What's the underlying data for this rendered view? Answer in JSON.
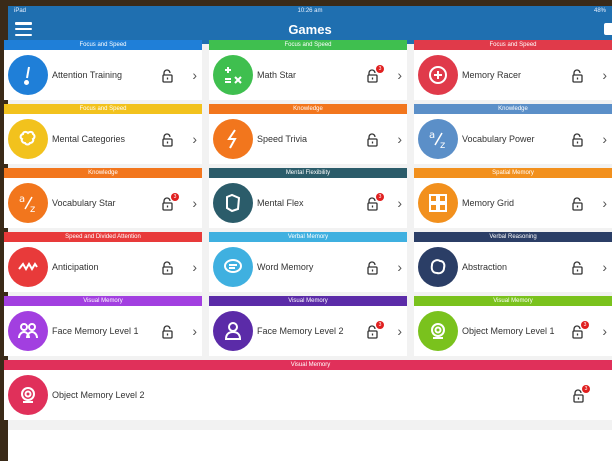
{
  "status": {
    "left": "iPad",
    "time": "10:26 am",
    "right": "48%"
  },
  "nav": {
    "title": "Games"
  },
  "colors": {
    "focus": "#1f7fd8",
    "knowledge": "#f2761d",
    "flex": "#2b5c6a",
    "spatial": "#f2761d",
    "speed": "#e83a3a",
    "verbal": "#6fd0ec",
    "reason": "#6b6e86",
    "visual": "#a23fe0"
  },
  "rows": [
    [
      {
        "category": "Focus and Speed",
        "name": "Attention Training",
        "icon": "exclamation-icon",
        "color": "#1f7fd8",
        "badge": ""
      },
      {
        "category": "Focus and Speed",
        "name": "Math Star",
        "icon": "math-symbols-icon",
        "color": "#3fbf4f",
        "badge": "3"
      },
      {
        "category": "Focus and Speed",
        "name": "Memory Racer",
        "icon": "target-face-icon",
        "color": "#e03a4a",
        "badge": ""
      }
    ],
    [
      {
        "category": "Focus and Speed",
        "name": "Mental Categories",
        "icon": "brain-icon",
        "color": "#f2c21d",
        "badge": ""
      },
      {
        "category": "Knowledge",
        "name": "Speed Trivia",
        "icon": "lightning-icon",
        "color": "#f2761d",
        "badge": ""
      },
      {
        "category": "Knowledge",
        "name": "Vocabulary Power",
        "icon": "letters-az-icon",
        "color": "#5b8fc8",
        "badge": ""
      }
    ],
    [
      {
        "category": "Knowledge",
        "name": "Vocabulary Star",
        "icon": "letters-az-icon",
        "color": "#f2761d",
        "badge": "3"
      },
      {
        "category": "Mental Flexibility",
        "name": "Mental Flex",
        "icon": "map-shape-icon",
        "color": "#2b5c6a",
        "badge": "3"
      },
      {
        "category": "Spatial Memory",
        "name": "Memory Grid",
        "icon": "grid-icon",
        "color": "#f2901d",
        "badge": ""
      }
    ],
    [
      {
        "category": "Speed and Divided Attention",
        "name": "Anticipation",
        "icon": "zigzag-icon",
        "color": "#e83a3a",
        "badge": ""
      },
      {
        "category": "Verbal Memory",
        "name": "Word Memory",
        "icon": "speech-bubble-icon",
        "color": "#3fb0e0",
        "badge": ""
      },
      {
        "category": "Verbal Reasoning",
        "name": "Abstraction",
        "icon": "blob-icon",
        "color": "#2b3e66",
        "badge": ""
      }
    ],
    [
      {
        "category": "Visual Memory",
        "name": "Face Memory Level 1",
        "icon": "faces-icon",
        "color": "#a23fe0",
        "badge": ""
      },
      {
        "category": "Visual Memory",
        "name": "Face Memory Level 2",
        "icon": "person-icon",
        "color": "#5b2ba8",
        "badge": "3"
      },
      {
        "category": "Visual Memory",
        "name": "Object Memory Level 1",
        "icon": "camera-icon",
        "color": "#7ac21d",
        "badge": "3"
      }
    ]
  ],
  "wide": {
    "category": "Visual Memory",
    "name": "Object Memory Level 2",
    "icon": "camera-icon",
    "color": "#e0305a",
    "badge": "3"
  }
}
